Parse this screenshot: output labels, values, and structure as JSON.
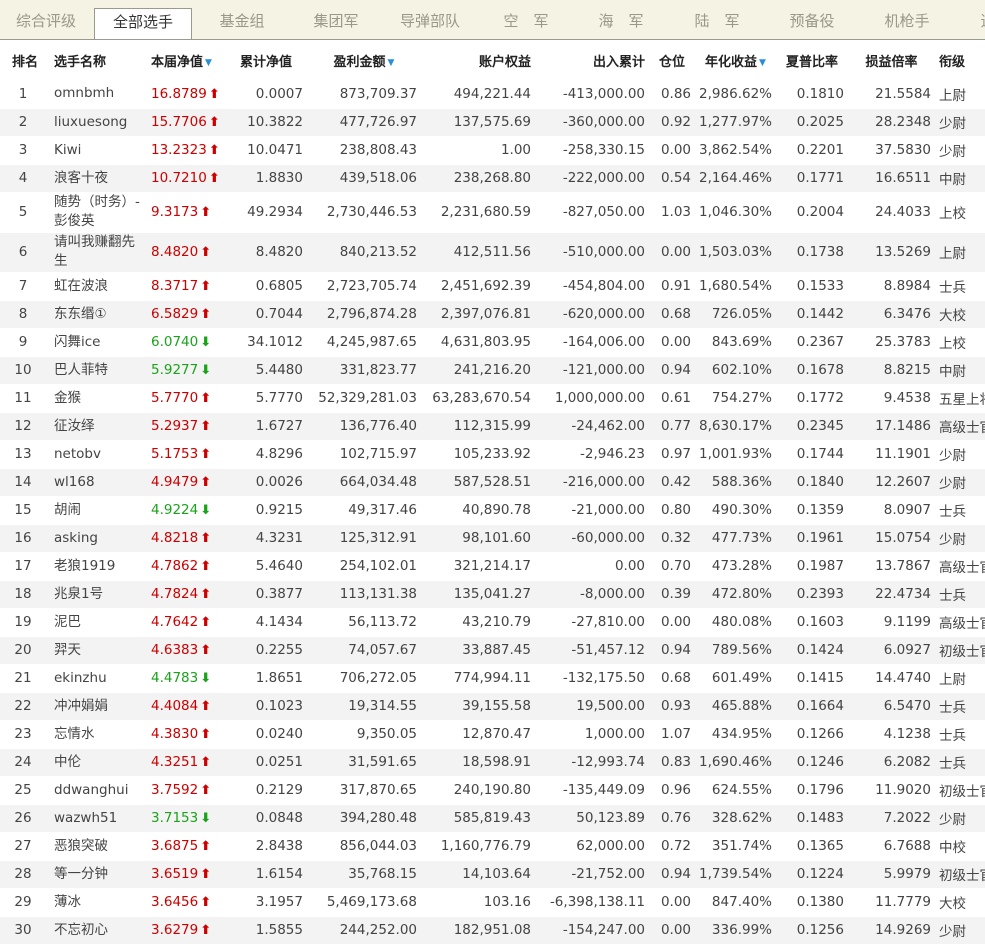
{
  "tabs": [
    {
      "label": "综合评级",
      "active": false
    },
    {
      "label": "全部选手",
      "active": true
    },
    {
      "label": "基金组",
      "active": false
    },
    {
      "label": "集团军",
      "active": false
    },
    {
      "label": "导弹部队",
      "active": false
    },
    {
      "label": "空　军",
      "active": false
    },
    {
      "label": "海　军",
      "active": false
    },
    {
      "label": "陆　军",
      "active": false
    },
    {
      "label": "预备役",
      "active": false
    },
    {
      "label": "机枪手",
      "active": false
    },
    {
      "label": "追",
      "active": false
    }
  ],
  "columns": [
    {
      "label": "排名",
      "sortable": false
    },
    {
      "label": "选手名称",
      "sortable": false
    },
    {
      "label": "本届净值",
      "sortable": true
    },
    {
      "label": "累计净值",
      "sortable": false
    },
    {
      "label": "盈利金额",
      "sortable": true
    },
    {
      "label": "账户权益",
      "sortable": false
    },
    {
      "label": "出入累计",
      "sortable": false
    },
    {
      "label": "仓位",
      "sortable": false
    },
    {
      "label": "年化收益",
      "sortable": true
    },
    {
      "label": "夏普比率",
      "sortable": false
    },
    {
      "label": "损益倍率",
      "sortable": false
    },
    {
      "label": "衔级",
      "sortable": false
    }
  ],
  "colors": {
    "up": "#cc0000",
    "down": "#1aa31a",
    "sort": "#2a8fd6"
  },
  "rows": [
    {
      "rank": "1",
      "name": "omnbmh",
      "nav": "16.8789",
      "trend": "up",
      "cum": "0.0007",
      "profit": "873,709.37",
      "equity": "494,221.44",
      "flow": "-413,000.00",
      "pos": "0.86",
      "annual": "2,986.62%",
      "sharpe": "0.1810",
      "pl": "21.5584",
      "title": "上尉"
    },
    {
      "rank": "2",
      "name": "liuxuesong",
      "nav": "15.7706",
      "trend": "up",
      "cum": "10.3822",
      "profit": "477,726.97",
      "equity": "137,575.69",
      "flow": "-360,000.00",
      "pos": "0.92",
      "annual": "1,277.97%",
      "sharpe": "0.2025",
      "pl": "28.2348",
      "title": "少尉"
    },
    {
      "rank": "3",
      "name": "Kiwi",
      "nav": "13.2323",
      "trend": "up",
      "cum": "10.0471",
      "profit": "238,808.43",
      "equity": "1.00",
      "flow": "-258,330.15",
      "pos": "0.00",
      "annual": "3,862.54%",
      "sharpe": "0.2201",
      "pl": "37.5830",
      "title": "少尉"
    },
    {
      "rank": "4",
      "name": "浪客十夜",
      "nav": "10.7210",
      "trend": "up",
      "cum": "1.8830",
      "profit": "439,518.06",
      "equity": "238,268.80",
      "flow": "-222,000.00",
      "pos": "0.54",
      "annual": "2,164.46%",
      "sharpe": "0.1771",
      "pl": "16.6511",
      "title": "中尉"
    },
    {
      "rank": "5",
      "name": "随势（时务）-彭俊英",
      "nav": "9.3173",
      "trend": "up",
      "cum": "49.2934",
      "profit": "2,730,446.53",
      "equity": "2,231,680.59",
      "flow": "-827,050.00",
      "pos": "1.03",
      "annual": "1,046.30%",
      "sharpe": "0.2004",
      "pl": "24.4033",
      "title": "上校",
      "tall": true
    },
    {
      "rank": "6",
      "name": "请叫我赚翻先生",
      "nav": "8.4820",
      "trend": "up",
      "cum": "8.4820",
      "profit": "840,213.52",
      "equity": "412,511.56",
      "flow": "-510,000.00",
      "pos": "0.00",
      "annual": "1,503.03%",
      "sharpe": "0.1738",
      "pl": "13.5269",
      "title": "上尉",
      "tall": true
    },
    {
      "rank": "7",
      "name": "虹在波浪",
      "nav": "8.3717",
      "trend": "up",
      "cum": "0.6805",
      "profit": "2,723,705.74",
      "equity": "2,451,692.39",
      "flow": "-454,804.00",
      "pos": "0.91",
      "annual": "1,680.54%",
      "sharpe": "0.1533",
      "pl": "8.8984",
      "title": "士兵"
    },
    {
      "rank": "8",
      "name": "东东缗①",
      "nav": "6.5829",
      "trend": "up",
      "cum": "0.7044",
      "profit": "2,796,874.28",
      "equity": "2,397,076.81",
      "flow": "-620,000.00",
      "pos": "0.68",
      "annual": "726.05%",
      "sharpe": "0.1442",
      "pl": "6.3476",
      "title": "大校"
    },
    {
      "rank": "9",
      "name": "闪舞ice",
      "nav": "6.0740",
      "trend": "down",
      "cum": "34.1012",
      "profit": "4,245,987.65",
      "equity": "4,631,803.95",
      "flow": "-164,006.00",
      "pos": "0.00",
      "annual": "843.69%",
      "sharpe": "0.2367",
      "pl": "25.3783",
      "title": "上校"
    },
    {
      "rank": "10",
      "name": "巴人菲特",
      "nav": "5.9277",
      "trend": "down",
      "cum": "5.4480",
      "profit": "331,823.77",
      "equity": "241,216.20",
      "flow": "-121,000.00",
      "pos": "0.94",
      "annual": "602.10%",
      "sharpe": "0.1678",
      "pl": "8.8215",
      "title": "中尉"
    },
    {
      "rank": "11",
      "name": "金猴",
      "nav": "5.7770",
      "trend": "up",
      "cum": "5.7770",
      "profit": "52,329,281.03",
      "equity": "63,283,670.54",
      "flow": "1,000,000.00",
      "pos": "0.61",
      "annual": "754.27%",
      "sharpe": "0.1772",
      "pl": "9.4538",
      "title": "五星上将"
    },
    {
      "rank": "12",
      "name": "征汝绎",
      "nav": "5.2937",
      "trend": "up",
      "cum": "1.6727",
      "profit": "136,776.40",
      "equity": "112,315.99",
      "flow": "-24,462.00",
      "pos": "0.77",
      "annual": "8,630.17%",
      "sharpe": "0.2345",
      "pl": "17.1486",
      "title": "高级士官"
    },
    {
      "rank": "13",
      "name": "netobv",
      "nav": "5.1753",
      "trend": "up",
      "cum": "4.8296",
      "profit": "102,715.97",
      "equity": "105,233.92",
      "flow": "-2,946.23",
      "pos": "0.97",
      "annual": "1,001.93%",
      "sharpe": "0.1744",
      "pl": "11.1901",
      "title": "少尉"
    },
    {
      "rank": "14",
      "name": "wl168",
      "nav": "4.9479",
      "trend": "up",
      "cum": "0.0026",
      "profit": "664,034.48",
      "equity": "587,528.51",
      "flow": "-216,000.00",
      "pos": "0.42",
      "annual": "588.36%",
      "sharpe": "0.1840",
      "pl": "12.2607",
      "title": "少尉"
    },
    {
      "rank": "15",
      "name": "胡闹",
      "nav": "4.9224",
      "trend": "down",
      "cum": "0.9215",
      "profit": "49,317.46",
      "equity": "40,890.78",
      "flow": "-21,000.00",
      "pos": "0.80",
      "annual": "490.30%",
      "sharpe": "0.1359",
      "pl": "8.0907",
      "title": "士兵"
    },
    {
      "rank": "16",
      "name": "asking",
      "nav": "4.8218",
      "trend": "up",
      "cum": "4.3231",
      "profit": "125,312.91",
      "equity": "98,101.60",
      "flow": "-60,000.00",
      "pos": "0.32",
      "annual": "477.73%",
      "sharpe": "0.1961",
      "pl": "15.0754",
      "title": "少尉"
    },
    {
      "rank": "17",
      "name": "老狼1919",
      "nav": "4.7862",
      "trend": "up",
      "cum": "5.4640",
      "profit": "254,102.01",
      "equity": "321,214.17",
      "flow": "0.00",
      "pos": "0.70",
      "annual": "473.28%",
      "sharpe": "0.1987",
      "pl": "13.7867",
      "title": "高级士官"
    },
    {
      "rank": "18",
      "name": "兆泉1号",
      "nav": "4.7824",
      "trend": "up",
      "cum": "0.3877",
      "profit": "113,131.38",
      "equity": "135,041.27",
      "flow": "-8,000.00",
      "pos": "0.39",
      "annual": "472.80%",
      "sharpe": "0.2393",
      "pl": "22.4734",
      "title": "士兵"
    },
    {
      "rank": "19",
      "name": "泥巴",
      "nav": "4.7642",
      "trend": "up",
      "cum": "4.1434",
      "profit": "56,113.72",
      "equity": "43,210.79",
      "flow": "-27,810.00",
      "pos": "0.00",
      "annual": "480.08%",
      "sharpe": "0.1603",
      "pl": "9.1199",
      "title": "高级士官"
    },
    {
      "rank": "20",
      "name": "羿天",
      "nav": "4.6383",
      "trend": "up",
      "cum": "0.2255",
      "profit": "74,057.67",
      "equity": "33,887.45",
      "flow": "-51,457.12",
      "pos": "0.94",
      "annual": "789.56%",
      "sharpe": "0.1424",
      "pl": "6.0927",
      "title": "初级士官"
    },
    {
      "rank": "21",
      "name": "ekinzhu",
      "nav": "4.4783",
      "trend": "down",
      "cum": "1.8651",
      "profit": "706,272.05",
      "equity": "774,994.11",
      "flow": "-132,175.50",
      "pos": "0.68",
      "annual": "601.49%",
      "sharpe": "0.1415",
      "pl": "14.4740",
      "title": "上尉"
    },
    {
      "rank": "22",
      "name": "冲冲娟娟",
      "nav": "4.4084",
      "trend": "up",
      "cum": "0.1023",
      "profit": "19,314.55",
      "equity": "39,155.58",
      "flow": "19,500.00",
      "pos": "0.93",
      "annual": "465.88%",
      "sharpe": "0.1664",
      "pl": "6.5470",
      "title": "士兵"
    },
    {
      "rank": "23",
      "name": "忘情水",
      "nav": "4.3830",
      "trend": "up",
      "cum": "0.0240",
      "profit": "9,350.05",
      "equity": "12,870.47",
      "flow": "1,000.00",
      "pos": "1.07",
      "annual": "434.95%",
      "sharpe": "0.1266",
      "pl": "4.1238",
      "title": "士兵"
    },
    {
      "rank": "24",
      "name": "中伦",
      "nav": "4.3251",
      "trend": "up",
      "cum": "0.0251",
      "profit": "31,591.65",
      "equity": "18,598.91",
      "flow": "-12,993.74",
      "pos": "0.83",
      "annual": "1,690.46%",
      "sharpe": "0.1246",
      "pl": "6.2082",
      "title": "士兵"
    },
    {
      "rank": "25",
      "name": "ddwanghui",
      "nav": "3.7592",
      "trend": "up",
      "cum": "0.2129",
      "profit": "317,870.65",
      "equity": "240,190.80",
      "flow": "-135,449.09",
      "pos": "0.96",
      "annual": "624.55%",
      "sharpe": "0.1796",
      "pl": "11.9020",
      "title": "初级士官"
    },
    {
      "rank": "26",
      "name": "wazwh51",
      "nav": "3.7153",
      "trend": "down",
      "cum": "0.0848",
      "profit": "394,280.48",
      "equity": "585,819.43",
      "flow": "50,123.89",
      "pos": "0.76",
      "annual": "328.62%",
      "sharpe": "0.1483",
      "pl": "7.2022",
      "title": "少尉"
    },
    {
      "rank": "27",
      "name": "恶狼突破",
      "nav": "3.6875",
      "trend": "up",
      "cum": "2.8438",
      "profit": "856,044.03",
      "equity": "1,160,776.79",
      "flow": "62,000.00",
      "pos": "0.72",
      "annual": "351.74%",
      "sharpe": "0.1365",
      "pl": "6.7688",
      "title": "中校"
    },
    {
      "rank": "28",
      "name": "等一分钟",
      "nav": "3.6519",
      "trend": "up",
      "cum": "1.6154",
      "profit": "35,768.15",
      "equity": "14,103.64",
      "flow": "-21,752.00",
      "pos": "0.94",
      "annual": "1,739.54%",
      "sharpe": "0.1224",
      "pl": "5.9979",
      "title": "初级士官"
    },
    {
      "rank": "29",
      "name": "薄冰",
      "nav": "3.6456",
      "trend": "up",
      "cum": "3.1957",
      "profit": "5,469,173.68",
      "equity": "103.16",
      "flow": "-6,398,138.11",
      "pos": "0.00",
      "annual": "847.40%",
      "sharpe": "0.1380",
      "pl": "11.7779",
      "title": "大校"
    },
    {
      "rank": "30",
      "name": "不忘初心",
      "nav": "3.6279",
      "trend": "up",
      "cum": "1.5855",
      "profit": "244,252.00",
      "equity": "182,951.08",
      "flow": "-154,247.00",
      "pos": "0.00",
      "annual": "336.99%",
      "sharpe": "0.1256",
      "pl": "14.9269",
      "title": "少尉"
    }
  ]
}
